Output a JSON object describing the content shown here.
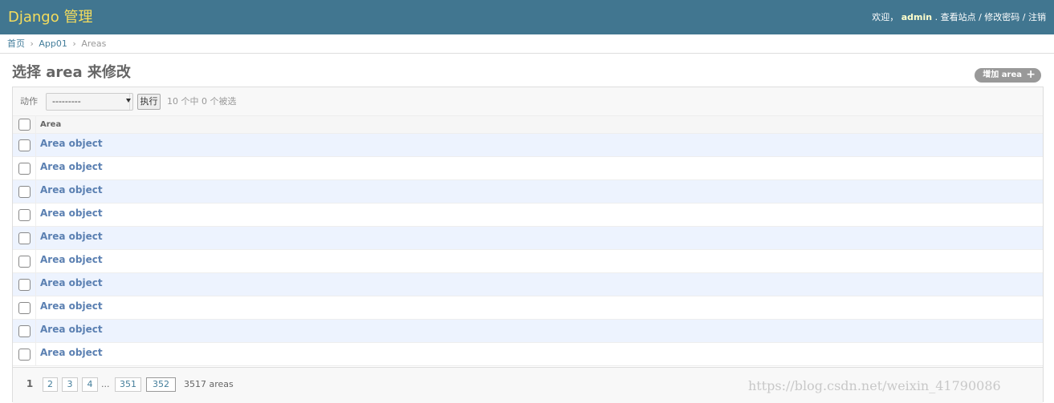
{
  "header": {
    "brand": "Django 管理",
    "welcome": "欢迎，",
    "username": "admin",
    "period": ". ",
    "view_site": "查看站点",
    "separator": " / ",
    "change_password": "修改密码",
    "logout": "注销"
  },
  "breadcrumbs": {
    "home": "首页",
    "app": "App01",
    "model": "Areas",
    "separator": "›"
  },
  "content": {
    "title": "选择 area 来修改",
    "add_button": "增加 area",
    "add_icon": "+"
  },
  "actions": {
    "label": "动作",
    "select_value": "---------",
    "go_button": "执行",
    "selection_count": "10 个中 0 个被选"
  },
  "table": {
    "column_header": "Area",
    "rows": [
      "Area object",
      "Area object",
      "Area object",
      "Area object",
      "Area object",
      "Area object",
      "Area object",
      "Area object",
      "Area object",
      "Area object"
    ]
  },
  "paginator": {
    "current": "1",
    "pages": [
      "2",
      "3",
      "4"
    ],
    "ellipsis": "...",
    "tail_pages": [
      "351",
      "352"
    ],
    "result_count": "3517 areas"
  },
  "watermark": "https://blog.csdn.net/weixin_41790086",
  "colors": {
    "header_bg": "#417690",
    "brand": "#f5dd5d",
    "link": "#5b80b2",
    "row_alt": "#edf3fe"
  }
}
